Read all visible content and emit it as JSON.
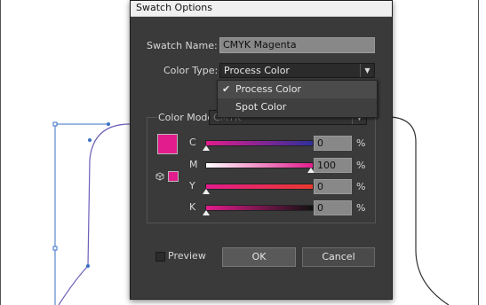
{
  "dialog": {
    "title": "Swatch Options",
    "swatch_name_label": "Swatch Name:",
    "swatch_name_value": "CMYK Magenta",
    "color_type_label": "Color Type:",
    "color_type_value": "Process Color",
    "color_mode_label": "Color Mode:",
    "color_mode_value": "CMYK",
    "swatch_color": "#e21c8c",
    "channels": [
      {
        "label": "C",
        "value": "0",
        "unit": "%",
        "level": 0
      },
      {
        "label": "M",
        "value": "100",
        "unit": "%",
        "level": 100
      },
      {
        "label": "Y",
        "value": "0",
        "unit": "%",
        "level": 0
      },
      {
        "label": "K",
        "value": "0",
        "unit": "%",
        "level": 0
      }
    ],
    "preview_label": "Preview",
    "preview_checked": false,
    "ok_label": "OK",
    "cancel_label": "Cancel"
  },
  "dropdown": {
    "items": [
      {
        "label": "Process Color",
        "checked": true
      },
      {
        "label": "Spot Color",
        "checked": false
      }
    ]
  },
  "colors": {
    "dialog_bg": "#3a3a3a",
    "magenta": "#e21c8c",
    "path_stroke": "#333333",
    "anchor_blue": "#3a6fc4"
  }
}
